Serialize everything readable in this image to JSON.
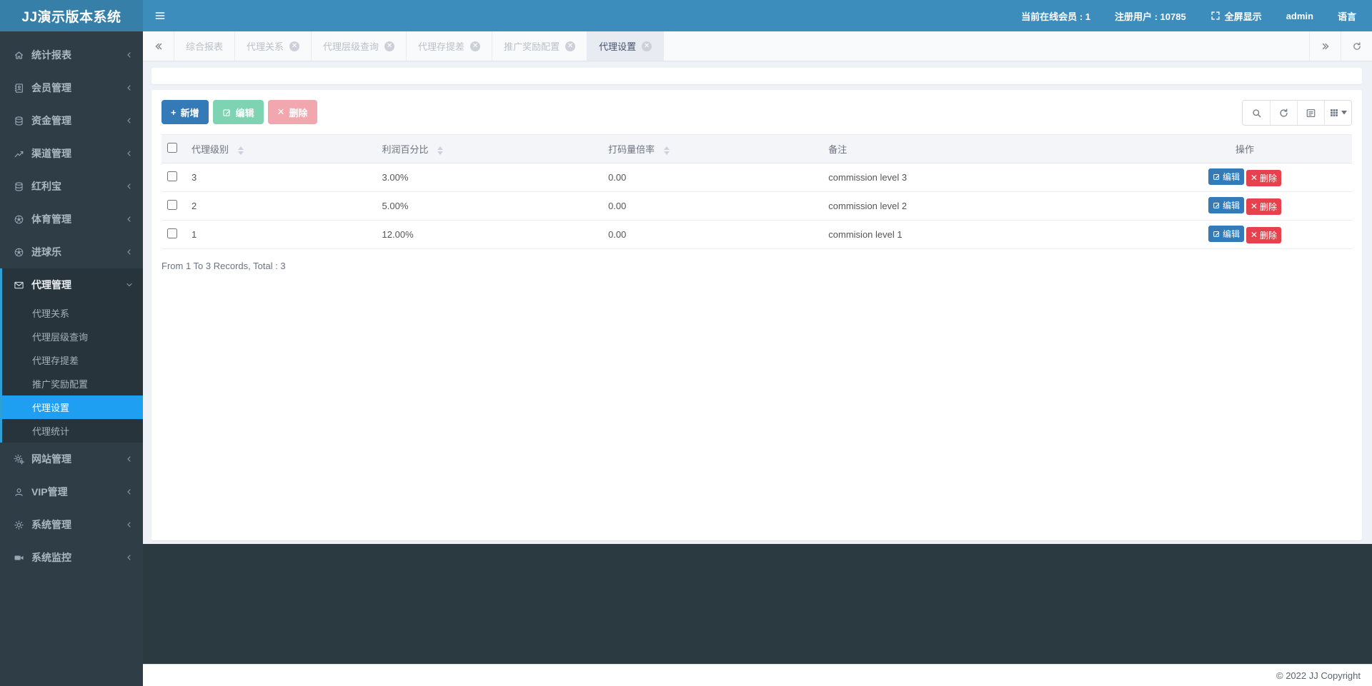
{
  "header": {
    "brand": "JJ演示版本系统",
    "online": "当前在线会员 : 1",
    "registered": "注册用户 : 10785",
    "fullscreen": "全屏显示",
    "user": "admin",
    "language": "语言"
  },
  "sidebar": {
    "items": [
      {
        "label": "统计报表"
      },
      {
        "label": "会员管理"
      },
      {
        "label": "资金管理"
      },
      {
        "label": "渠道管理"
      },
      {
        "label": "红利宝"
      },
      {
        "label": "体育管理"
      },
      {
        "label": "进球乐"
      },
      {
        "label": "代理管理",
        "children": [
          "代理关系",
          "代理层级查询",
          "代理存提差",
          "推广奖励配置",
          "代理设置",
          "代理统计"
        ],
        "active_child": "代理设置"
      },
      {
        "label": "网站管理"
      },
      {
        "label": "VIP管理"
      },
      {
        "label": "系统管理"
      },
      {
        "label": "系统监控"
      }
    ]
  },
  "tabs": {
    "items": [
      {
        "label": "综合报表",
        "closable": false
      },
      {
        "label": "代理关系",
        "closable": true
      },
      {
        "label": "代理层级查询",
        "closable": true
      },
      {
        "label": "代理存提差",
        "closable": true
      },
      {
        "label": "推广奖励配置",
        "closable": true
      },
      {
        "label": "代理设置",
        "closable": true,
        "active": true
      }
    ],
    "close_glyph": "✕"
  },
  "toolbar": {
    "add": "新增",
    "edit": "编辑",
    "delete": "删除"
  },
  "table": {
    "columns": {
      "level": "代理级别",
      "profit": "利润百分比",
      "rollover": "打码量倍率",
      "remark": "备注",
      "actions": "操作"
    },
    "rows": [
      {
        "level": "3",
        "profit": "3.00%",
        "rollover": "0.00",
        "remark": "commission level 3"
      },
      {
        "level": "2",
        "profit": "5.00%",
        "rollover": "0.00",
        "remark": "commission level 2"
      },
      {
        "level": "1",
        "profit": "12.00%",
        "rollover": "0.00",
        "remark": "commision level 1"
      }
    ],
    "action_edit": "编辑",
    "action_delete": "删除",
    "summary": "From 1 To 3 Records, Total : 3"
  },
  "footer": {
    "copyright": "© 2022 JJ Copyright"
  },
  "colors": {
    "navbar": "#3c8dbc",
    "logo": "#367fa9",
    "sidebar": "#2e3d46",
    "active_item": "#1e9ff2",
    "primary": "#337ab7",
    "danger": "#e5424e",
    "edit_disabled": "#7ed3b2",
    "delete_disabled": "#f2a6ae"
  }
}
